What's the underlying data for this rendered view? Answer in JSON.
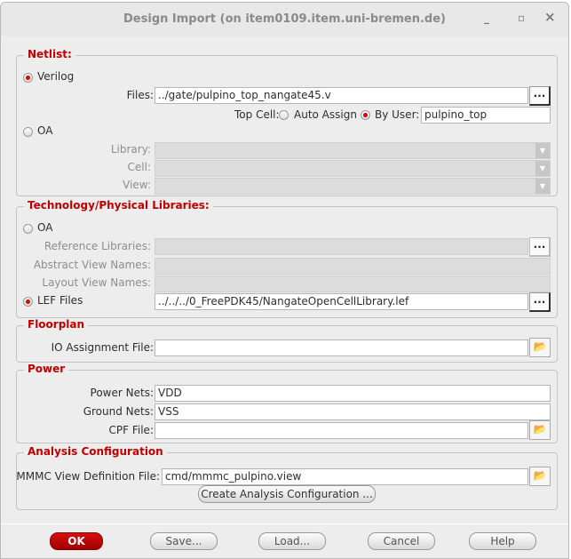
{
  "window": {
    "title": "Design Import (on item0109.item.uni-bremen.de)",
    "minimize": "_",
    "maximize": "▫",
    "close": "×"
  },
  "netlist": {
    "label": "Netlist:",
    "verilog": "Verilog",
    "files_label": "Files:",
    "files_value": "../gate/pulpino_top_nangate45.v",
    "browse": "...",
    "top_cell_label": "Top Cell:",
    "auto_assign": "Auto Assign",
    "by_user": "By User:",
    "top_cell_value": "pulpino_top",
    "oa": "OA",
    "library_label": "Library:",
    "cell_label": "Cell:",
    "view_label": "View:"
  },
  "tech": {
    "label": "Technology/Physical Libraries:",
    "oa": "OA",
    "ref_libs": "Reference Libraries:",
    "abstract": "Abstract View Names:",
    "layout": "Layout View Names:",
    "lef": "LEF Files",
    "lef_value": "../../../0_FreePDK45/NangateOpenCellLibrary.lef",
    "browse": "..."
  },
  "floorplan": {
    "label": "Floorplan",
    "io_label": "IO Assignment File:",
    "io_value": ""
  },
  "power": {
    "label": "Power",
    "power_nets_label": "Power Nets:",
    "power_nets": "VDD",
    "ground_nets_label": "Ground Nets:",
    "ground_nets": "VSS",
    "cpf_label": "CPF File:",
    "cpf_value": ""
  },
  "analysis": {
    "label": "Analysis Configuration",
    "mmmc_label": "MMMC View Definition File:",
    "mmmc_value": "cmd/mmmc_pulpino.view",
    "create": "Create Analysis Configuration ..."
  },
  "buttons": {
    "ok": "OK",
    "save": "Save...",
    "load": "Load...",
    "cancel": "Cancel",
    "help": "Help"
  }
}
